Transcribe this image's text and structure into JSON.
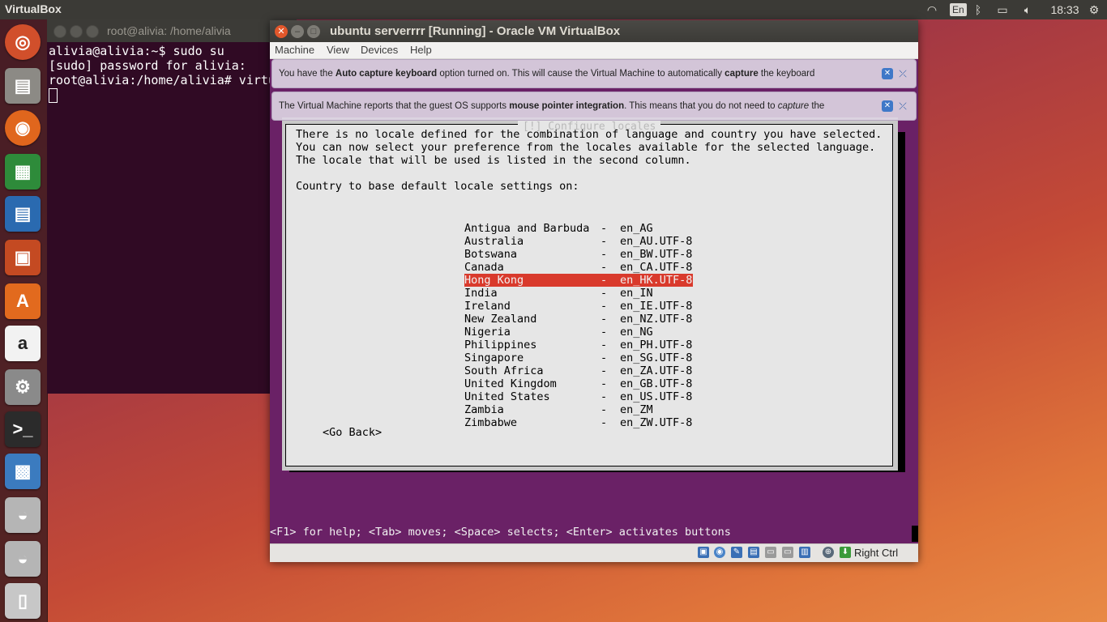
{
  "top_panel": {
    "app_title": "VirtualBox",
    "keyboard_layout": "En",
    "clock": "18:33"
  },
  "terminal": {
    "title": "root@alivia: /home/alivia",
    "lines": [
      "alivia@alivia:~$ sudo su",
      "[sudo] password for alivia:",
      "root@alivia:/home/alivia# virtu"
    ]
  },
  "vbox": {
    "title": "ubuntu serverrrr [Running] - Oracle VM VirtualBox",
    "menu": [
      "Machine",
      "View",
      "Devices",
      "Help"
    ],
    "notice1": {
      "pre": "You have the ",
      "bold1": "Auto capture keyboard",
      "mid": " option turned on. This will cause the Virtual Machine to automatically ",
      "bold2": "capture",
      "post": " the keyboard"
    },
    "notice2": {
      "pre": "The Virtual Machine reports that the guest OS supports ",
      "bold1": "mouse pointer integration",
      "mid": ". This means that you do not need to ",
      "italic": "capture",
      "post": " the"
    },
    "host_key": "Right Ctrl"
  },
  "installer": {
    "dialog_title": "[!] Configure locales",
    "intro_lines": [
      "There is no locale defined for the combination of language and country you have selected.",
      "You can now select your preference from the locales available for the selected language.",
      "The locale that will be used is listed in the second column."
    ],
    "prompt": "Country to base default locale settings on:",
    "locales": [
      {
        "country": "Antigua and Barbuda",
        "code": "en_AG"
      },
      {
        "country": "Australia",
        "code": "en_AU.UTF-8"
      },
      {
        "country": "Botswana",
        "code": "en_BW.UTF-8"
      },
      {
        "country": "Canada",
        "code": "en_CA.UTF-8"
      },
      {
        "country": "Hong Kong",
        "code": "en_HK.UTF-8"
      },
      {
        "country": "India",
        "code": "en_IN"
      },
      {
        "country": "Ireland",
        "code": "en_IE.UTF-8"
      },
      {
        "country": "New Zealand",
        "code": "en_NZ.UTF-8"
      },
      {
        "country": "Nigeria",
        "code": "en_NG"
      },
      {
        "country": "Philippines",
        "code": "en_PH.UTF-8"
      },
      {
        "country": "Singapore",
        "code": "en_SG.UTF-8"
      },
      {
        "country": "South Africa",
        "code": "en_ZA.UTF-8"
      },
      {
        "country": "United Kingdom",
        "code": "en_GB.UTF-8"
      },
      {
        "country": "United States",
        "code": "en_US.UTF-8"
      },
      {
        "country": "Zambia",
        "code": "en_ZM"
      },
      {
        "country": "Zimbabwe",
        "code": "en_ZW.UTF-8"
      }
    ],
    "selected_index": 4,
    "dash": "-",
    "go_back": "<Go Back>",
    "help_line": "<F1> for help; <Tab> moves; <Space> selects; <Enter> activates buttons"
  },
  "colors": {
    "selection": "#d93a2c",
    "guest_background": "#6a2166",
    "terminal_background": "#300a24"
  }
}
